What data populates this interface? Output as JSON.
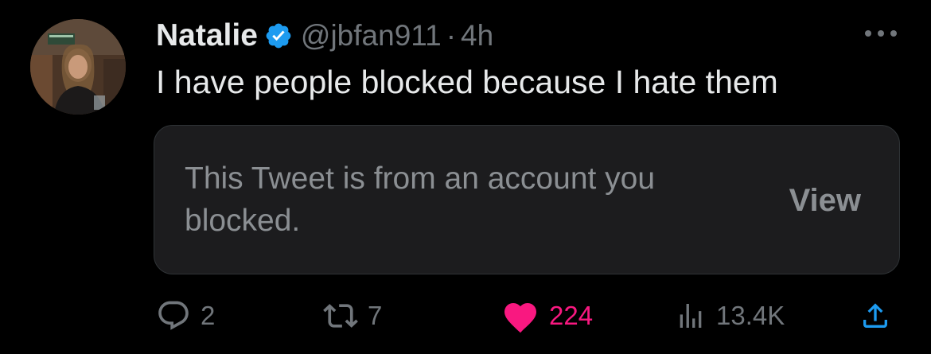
{
  "tweet": {
    "author": {
      "display_name": "Natalie",
      "handle": "@jbfan911",
      "verified": true
    },
    "separator": "·",
    "time": "4h",
    "text": "I have people blocked because I hate them",
    "quoted": {
      "message": "This Tweet is from an account you blocked.",
      "view_label": "View"
    },
    "actions": {
      "replies": "2",
      "retweets": "7",
      "likes": "224",
      "views": "13.4K"
    }
  },
  "colors": {
    "background": "#000000",
    "text_primary": "#e7e9ea",
    "text_secondary": "#71767b",
    "verified_blue": "#1d9bf0",
    "like_pink": "#f91880",
    "card_background": "#1c1c1e"
  },
  "icons": [
    "more-icon",
    "verified-badge-icon",
    "reply-icon",
    "retweet-icon",
    "heart-icon",
    "views-icon",
    "share-icon"
  ]
}
